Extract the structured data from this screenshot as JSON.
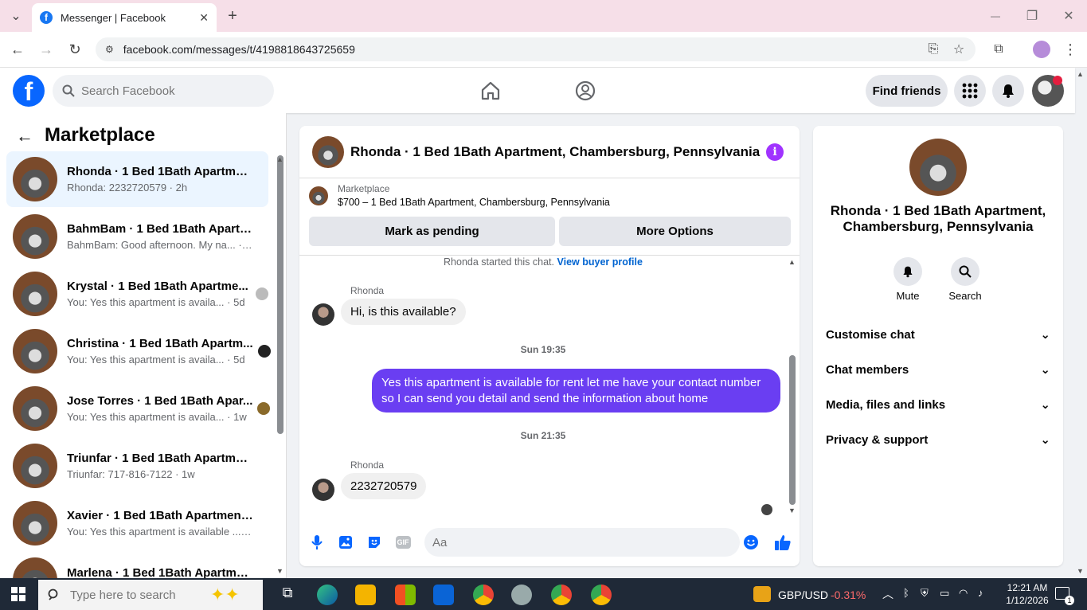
{
  "browser": {
    "tab_title": "Messenger | Facebook",
    "fav_letter": "f",
    "close_tab": "✕",
    "new_tab": "+",
    "url": "facebook.com/messages/t/4198818643725659",
    "minimize": "—",
    "restore": "❐",
    "close": "✕"
  },
  "fb": {
    "logo_letter": "f",
    "search_placeholder": "Search Facebook",
    "find_friends": "Find friends"
  },
  "sidebar": {
    "back": "←",
    "title": "Marketplace",
    "conversations": [
      {
        "name": "Rhonda · 1 Bed 1Bath Apartment...",
        "sub": "Rhonda: 2232720579 · 2h"
      },
      {
        "name": "BahmBam · 1 Bed 1Bath Apartm...",
        "sub": "BahmBam: Good afternoon. My na... · 3d"
      },
      {
        "name": "Krystal · 1 Bed 1Bath Apartme...",
        "sub": "You: Yes this apartment is availa... · 5d"
      },
      {
        "name": "Christina · 1 Bed 1Bath Apartm...",
        "sub": "You: Yes this apartment is availa... · 5d"
      },
      {
        "name": "Jose Torres · 1 Bed 1Bath Apar...",
        "sub": "You: Yes this apartment is availa... · 1w"
      },
      {
        "name": "Triunfar · 1 Bed 1Bath Apartment...",
        "sub": "Triunfar: 717-816-7122 · 1w"
      },
      {
        "name": "Xavier · 1 Bed 1Bath Apartment, ...",
        "sub": "You: Yes this apartment is available ... · 3w"
      },
      {
        "name": "Marlena · 1 Bed 1Bath Apartmen...",
        "sub": ""
      }
    ]
  },
  "chat": {
    "title": "Rhonda · 1 Bed 1Bath Apartment, Chambersburg, Pennsylvania",
    "info": "i",
    "listing_label": "Marketplace",
    "listing_desc": "$700 – 1 Bed 1Bath Apartment, Chambersburg, Pennsylvania",
    "mark_pending": "Mark as pending",
    "more_options": "More Options",
    "started_text": "Rhonda started this chat.",
    "view_buyer_profile": "View buyer profile",
    "messages": [
      {
        "sender": "Rhonda",
        "text": "Hi, is this available?"
      },
      {
        "stamp": "Sun 19:35"
      },
      {
        "text": "Yes this apartment is available for rent let me have your contact number so I can send you detail and send the information about home"
      },
      {
        "stamp": "Sun 21:35"
      },
      {
        "sender": "Rhonda",
        "text": "2232720579"
      }
    ],
    "input_placeholder": "Aa",
    "gif": "GIF"
  },
  "right_panel": {
    "name": "Rhonda · 1 Bed 1Bath Apartment, Chambersburg, Pennsylvania",
    "mute": "Mute",
    "search": "Search",
    "sections": [
      "Customise chat",
      "Chat members",
      "Media, files and links",
      "Privacy & support"
    ]
  },
  "taskbar": {
    "search_placeholder": "Type here to search",
    "ticker": "GBP/USD",
    "ticker_change": "-0.31%",
    "time": "12:21 AM",
    "date": "1/12/2026",
    "notif_count": "1"
  },
  "colors": {
    "fb_blue": "#0866ff",
    "outgoing_bubble": "#6a3ef2",
    "info_purple": "#a033ff",
    "negative": "#ff6b6b"
  }
}
